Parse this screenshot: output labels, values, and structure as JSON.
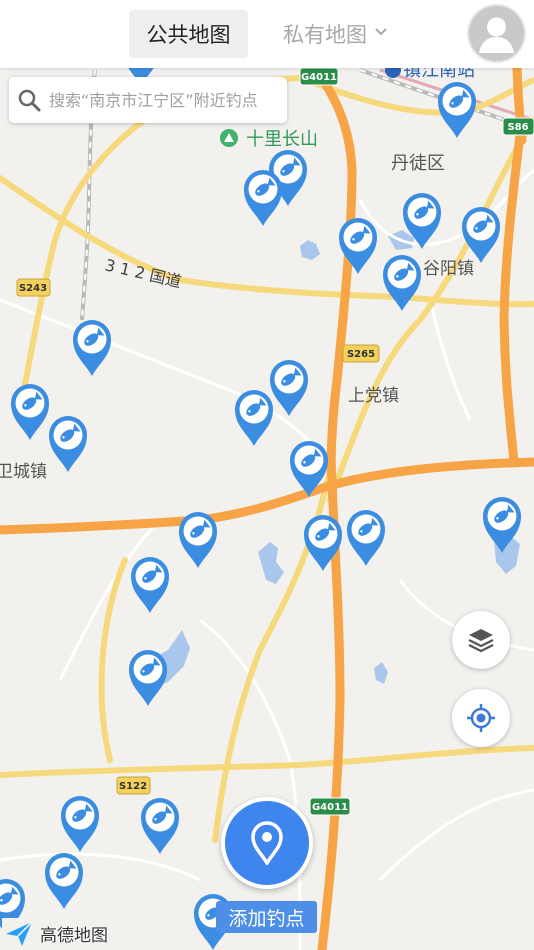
{
  "header": {
    "tab_public": "公共地图",
    "tab_private": "私有地图"
  },
  "search": {
    "placeholder": "搜索“南京市江宁区”附近钓点"
  },
  "map": {
    "places": {
      "shilichangshan": "十里长山",
      "danyangqu": "丹徒区",
      "guyangzhen": "谷阳镇",
      "shangdangzhen": "上党镇",
      "weichengzhen": "卫城镇",
      "tongjiangnan": "镇江南站",
      "road_312": "3 1 2 国道"
    },
    "road_badges": {
      "g4011_top": "G4011",
      "g4011_bottom": "G4011",
      "s86": "S86",
      "s243": "S243",
      "s265": "S265",
      "s122": "S122"
    },
    "colors": {
      "highway": "#f6a446",
      "road": "#f7d97d",
      "water": "#a9c7ec",
      "land": "#f2f1ee",
      "pin": "#3a8de0"
    }
  },
  "actions": {
    "add_spot_label": "添加钓点"
  },
  "brand": {
    "name": "高德地图"
  },
  "icons": {
    "search": "search-icon",
    "layers": "layers-icon",
    "locate": "locate-icon",
    "add_pin": "map-pin-icon",
    "fish_marker": "fish-marker-icon",
    "avatar": "user-avatar-icon",
    "dropdown": "chevron-down-icon",
    "brand": "amap-logo-icon",
    "park": "mountain-park-icon"
  }
}
